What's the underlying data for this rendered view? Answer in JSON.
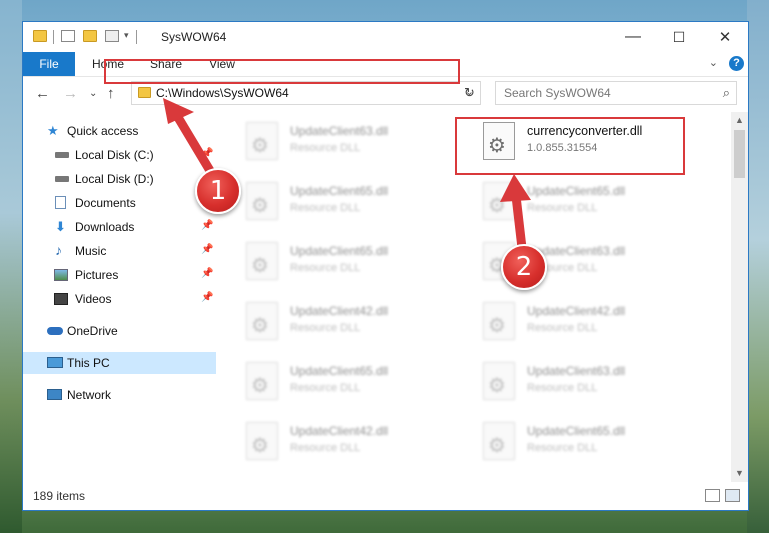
{
  "window": {
    "title": "SysWOW64",
    "controls": {
      "minimize": "—",
      "maximize": "☐",
      "close": "✕"
    }
  },
  "ribbon": {
    "tabs": [
      {
        "label": "File"
      },
      {
        "label": "Home"
      },
      {
        "label": "Share"
      },
      {
        "label": "View"
      }
    ],
    "help_label": "?"
  },
  "nav": {
    "address": "C:\\Windows\\SysWOW64",
    "search_placeholder": "Search SysWOW64"
  },
  "sidebar": {
    "items": [
      {
        "label": "Quick access",
        "icon": "star-icon"
      },
      {
        "label": "Local Disk (C:)",
        "icon": "drive-icon"
      },
      {
        "label": "Local Disk (D:)",
        "icon": "drive-icon"
      },
      {
        "label": "Documents",
        "icon": "documents-icon"
      },
      {
        "label": "Downloads",
        "icon": "downloads-icon"
      },
      {
        "label": "Music",
        "icon": "music-icon"
      },
      {
        "label": "Pictures",
        "icon": "pictures-icon"
      },
      {
        "label": "Videos",
        "icon": "videos-icon"
      },
      {
        "label": "OneDrive",
        "icon": "cloud-icon"
      },
      {
        "label": "This PC",
        "icon": "computer-icon",
        "selected": true
      },
      {
        "label": "Network",
        "icon": "network-icon"
      }
    ]
  },
  "files": {
    "left_column": [
      {
        "name": "UpdateClient63.dll",
        "type": "Resource DLL"
      },
      {
        "name": "UpdateClient65.dll",
        "type": "Resource DLL"
      },
      {
        "name": "UpdateClient65.dll",
        "type": "Resource DLL"
      },
      {
        "name": "UpdateClient42.dll",
        "type": "Resource DLL"
      },
      {
        "name": "UpdateClient65.dll",
        "type": "Resource DLL"
      },
      {
        "name": "UpdateClient42.dll",
        "type": "Resource DLL"
      }
    ],
    "right_column": [
      {
        "name": "UpdateClient65.dll",
        "type": "Resource DLL"
      },
      {
        "name": "UpdateClient63.dll",
        "type": "Resource DLL"
      },
      {
        "name": "UpdateClient42.dll",
        "type": "Resource DLL"
      },
      {
        "name": "UpdateClient63.dll",
        "type": "Resource DLL"
      },
      {
        "name": "UpdateClient65.dll",
        "type": "Resource DLL"
      }
    ],
    "target": {
      "name": "currencyconverter.dll",
      "version": "1.0.855.31554"
    }
  },
  "status": {
    "item_count": "189 items"
  },
  "annotations": {
    "step1": "1",
    "step2": "2",
    "color": "#d9393b"
  }
}
